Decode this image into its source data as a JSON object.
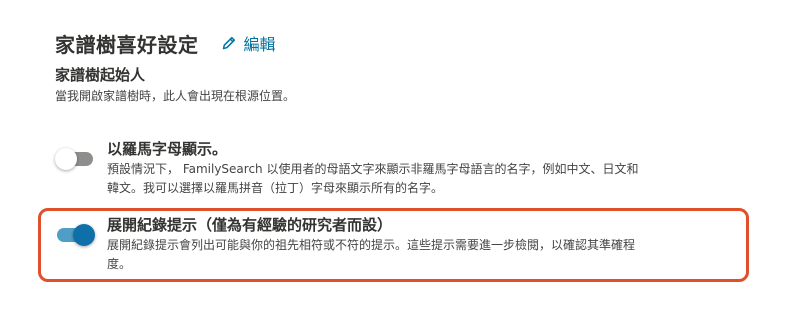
{
  "header": {
    "title": "家譜樹喜好設定",
    "edit_label": "編輯"
  },
  "starting_person": {
    "title": "家譜樹起始人",
    "description": "當我開啟家譜樹時，此人會出現在根源位置。"
  },
  "options": [
    {
      "title": "以羅馬字母顯示。",
      "description_line1": "預設情況下， FamilySearch 以使用者的母語文字來顯示非羅馬字母語言的名字，例如中文、日文和",
      "description_line2": "韓文。我可以選擇以羅馬拼音（拉丁）字母來顯示所有的名字。",
      "state": "off"
    },
    {
      "title": "展開紀錄提示（僅為有經驗的研究者而設）",
      "description_line1": "展開紀錄提示會列出可能與你的祖先相符或不符的提示。這些提示需要進一步檢閱，以確認其準確程",
      "description_line2": "度。",
      "state": "on"
    }
  ],
  "colors": {
    "accent": "#0074a3",
    "toggle_on": "#0f6fa8",
    "highlight": "#e0502b"
  },
  "icons": {
    "edit": "pencil-icon"
  }
}
